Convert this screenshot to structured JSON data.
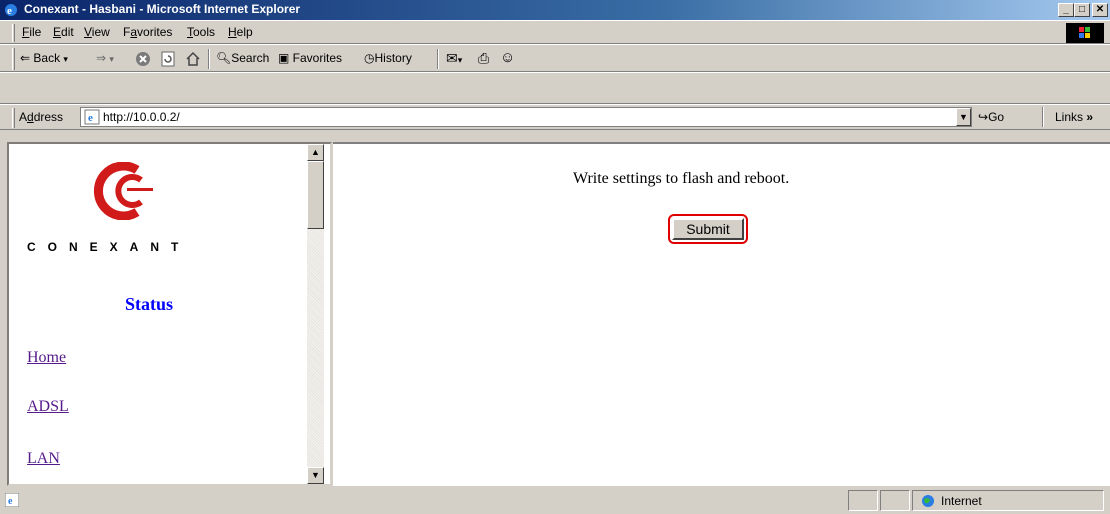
{
  "window": {
    "title": "Conexant - Hasbani - Microsoft Internet Explorer",
    "controls": {
      "minimize": "_",
      "maximize": "□",
      "close": "✕"
    }
  },
  "menu": {
    "items": [
      {
        "key": "F",
        "rest": "ile"
      },
      {
        "key": "E",
        "rest": "dit"
      },
      {
        "key": "V",
        "rest": "iew"
      },
      {
        "pre": "F",
        "key": "a",
        "rest": "vorites"
      },
      {
        "key": "T",
        "rest": "ools"
      },
      {
        "key": "H",
        "rest": "elp"
      }
    ]
  },
  "toolbar": {
    "back": "Back",
    "search": "Search",
    "favorites": "Favorites",
    "history": "History"
  },
  "address": {
    "label_key": "d",
    "label_pre": "A",
    "label_rest": "dress",
    "url": "http://10.0.0.2/",
    "go": "Go",
    "links": "Links"
  },
  "sidebar": {
    "brand": "CONEXANT",
    "heading": "Status",
    "links": [
      "Home",
      "ADSL",
      "LAN"
    ]
  },
  "main": {
    "message": "Write settings to flash and reboot.",
    "submit_label": "Submit"
  },
  "statusbar": {
    "zone": "Internet"
  },
  "colors": {
    "titlebar": "#0a246a",
    "logo_red": "#d11a1a",
    "heading_blue": "#0000ff",
    "highlight": "#e00000"
  }
}
